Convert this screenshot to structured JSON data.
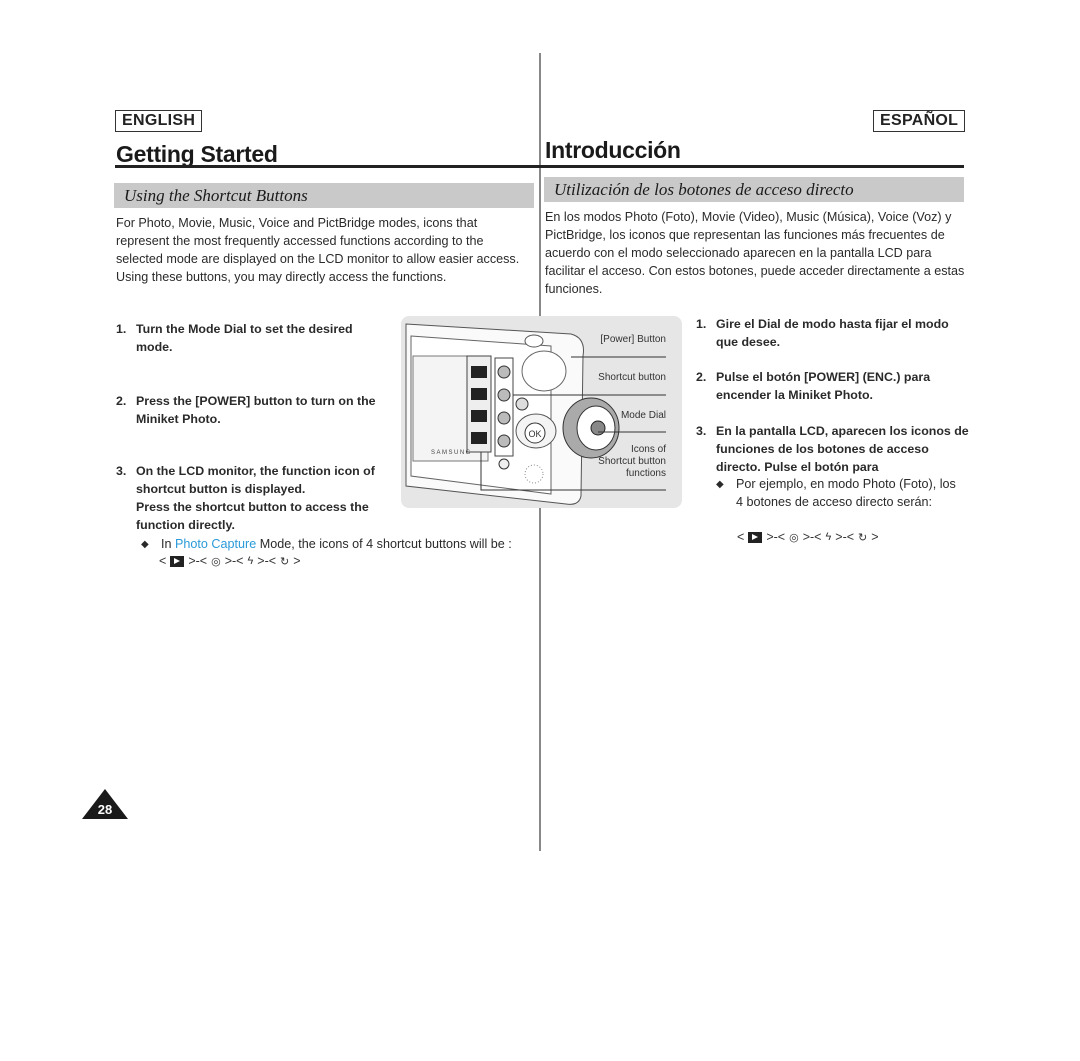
{
  "english": {
    "lang_label": "ENGLISH",
    "title": "Getting Started",
    "section": "Using the Shortcut Buttons",
    "intro": "For Photo, Movie, Music, Voice and PictBridge modes, icons that represent the most frequently accessed functions according to the selected mode are displayed on the LCD monitor to allow easier access. Using these buttons, you may directly access the functions.",
    "steps": [
      {
        "num": "1.",
        "text": "Turn the Mode Dial to set the desired mode."
      },
      {
        "num": "2.",
        "text": "Press the [POWER] button to turn on the Miniket Photo."
      },
      {
        "num": "3.",
        "text": "On the LCD monitor, the function icon of shortcut button is displayed.",
        "text2": "Press the shortcut button to access the function directly."
      }
    ],
    "bullet": {
      "prefix": "In ",
      "highlight": "Photo Capture",
      "suffix": " Mode, the icons of 4 shortcut buttons will be :"
    },
    "page_number": "28"
  },
  "spanish": {
    "lang_label": "ESPAÑOL",
    "title": "Introducción",
    "section": "Utilización de los botones de acceso directo",
    "intro": "En los modos Photo (Foto), Movie (Video), Music (Música), Voice (Voz) y PictBridge, los iconos que representan las funciones más frecuentes de acuerdo con el modo seleccionado aparecen en la pantalla LCD para facilitar el acceso. Con estos botones, puede acceder directamente a estas funciones.",
    "steps": [
      {
        "num": "1.",
        "text": "Gire el Dial de modo hasta fijar el modo que desee."
      },
      {
        "num": "2.",
        "text": "Pulse el botón [POWER] (ENC.) para encender la Miniket Photo."
      },
      {
        "num": "3.",
        "text": "En la pantalla LCD, aparecen los iconos de funciones de los botones de acceso directo. Pulse el botón para"
      }
    ],
    "bullet": {
      "text": "Por ejemplo, en modo Photo (Foto), los 4 botones de acceso directo serán:"
    }
  },
  "icon_sequence": {
    "open": "<",
    "sep": ">-<",
    "close": ">",
    "icons": [
      "playback-icon",
      "macro-eye-icon",
      "flash-off-icon",
      "self-timer-icon"
    ],
    "glyphs": [
      "",
      "◎",
      "⚡̸",
      "⏲"
    ]
  },
  "figure": {
    "labels": {
      "power": "[Power] Button",
      "shortcut": "Shortcut button",
      "mode_dial": "Mode Dial",
      "icons_line1": "Icons of",
      "icons_line2": "Shortcut button",
      "icons_line3": "functions"
    },
    "ok_label": "OK",
    "brand": "SAMSUNG"
  },
  "colors": {
    "highlight": "#2a9ad8",
    "section_bar": "#c9c9c9"
  }
}
